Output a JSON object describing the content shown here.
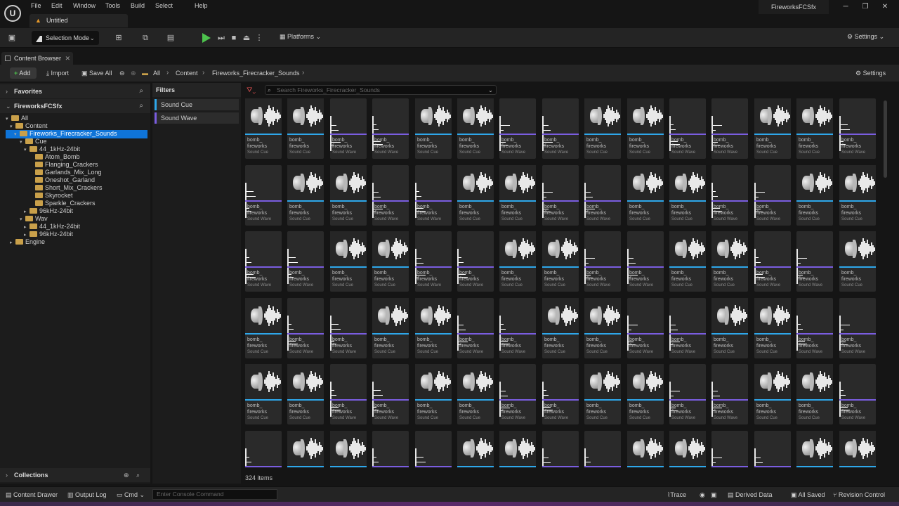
{
  "window": {
    "project_name": "FireworksFCSfx",
    "document_tab": "Untitled",
    "logo": "U",
    "controls": [
      "─",
      "❐",
      "✕"
    ]
  },
  "menu": [
    "File",
    "Edit",
    "Window",
    "Tools",
    "Build",
    "Select",
    "Help"
  ],
  "toolbar": {
    "selection_mode": "Selection Mode",
    "platforms": "Platforms",
    "settings": "Settings"
  },
  "content_browser": {
    "tab_label": "Content Browser",
    "add": "Add",
    "import": "Import",
    "save_all": "Save All",
    "breadcrumb": [
      "All",
      "Content",
      "Fireworks_Firecracker_Sounds"
    ],
    "settings": "Settings",
    "search_placeholder": "Search Fireworks_Firecracker_Sounds",
    "item_count": "324 items"
  },
  "sidebar": {
    "favorites": "Favorites",
    "project": "FireworksFCSfx",
    "collections": "Collections",
    "tree": [
      "All",
      "Content",
      "Fireworks_Firecracker_Sounds",
      "Cue",
      "44_1kHz-24bit",
      "Atom_Bomb",
      "Flanging_Crackers",
      "Garlands_Mix_Long",
      "Oneshot_Garland",
      "Short_Mix_Crackers",
      "Skyrocket",
      "Sparkle_Crackers",
      "96kHz-24bit",
      "Wav",
      "44_1kHz-24bit",
      "96kHz-24bit",
      "Engine"
    ]
  },
  "filters": {
    "title": "Filters",
    "items": [
      "Sound Cue",
      "Sound Wave"
    ]
  },
  "asset_tile": {
    "name_line1": "bomb_",
    "name_line2": "fireworks"
  },
  "asset_types": {
    "cue": "Sound Cue",
    "wave": "Sound Wave"
  },
  "asset_grid": {
    "rows": [
      [
        "cue",
        "cue",
        "wave",
        "wave",
        "cue",
        "cue",
        "wave",
        "wave",
        "cue",
        "cue",
        "wave",
        "wave",
        "cue",
        "cue",
        "wave"
      ],
      [
        "wave",
        "cue",
        "cue",
        "wave",
        "wave",
        "cue",
        "cue",
        "wave",
        "wave",
        "cue",
        "cue",
        "wave",
        "wave",
        "cue",
        "cue"
      ],
      [
        "wave",
        "wave",
        "cue",
        "cue",
        "wave",
        "wave",
        "cue",
        "cue",
        "wave",
        "wave",
        "cue",
        "cue",
        "wave",
        "wave",
        "cue"
      ],
      [
        "cue",
        "wave",
        "wave",
        "cue",
        "cue",
        "wave",
        "wave",
        "cue",
        "cue",
        "wave",
        "wave",
        "cue",
        "cue",
        "wave",
        "wave"
      ],
      [
        "cue",
        "cue",
        "wave",
        "wave",
        "cue",
        "cue",
        "wave",
        "wave",
        "cue",
        "cue",
        "wave",
        "wave",
        "cue",
        "cue",
        "wave"
      ],
      [
        "wave",
        "cue",
        "cue",
        "wave",
        "wave",
        "cue",
        "cue",
        "wave",
        "wave",
        "cue",
        "cue",
        "wave",
        "wave",
        "cue",
        "cue"
      ]
    ]
  },
  "colors": {
    "cue_strip": "#2ea7ea",
    "wave_strip": "#7a5de0",
    "selection": "#0f74d8",
    "play": "#4dc24d"
  },
  "statusbar": {
    "content_drawer": "Content Drawer",
    "output_log": "Output Log",
    "cmd": "Cmd",
    "console_placeholder": "Enter Console Command",
    "trace": "Trace",
    "derived_data": "Derived Data",
    "all_saved": "All Saved",
    "revision_control": "Revision Control"
  }
}
